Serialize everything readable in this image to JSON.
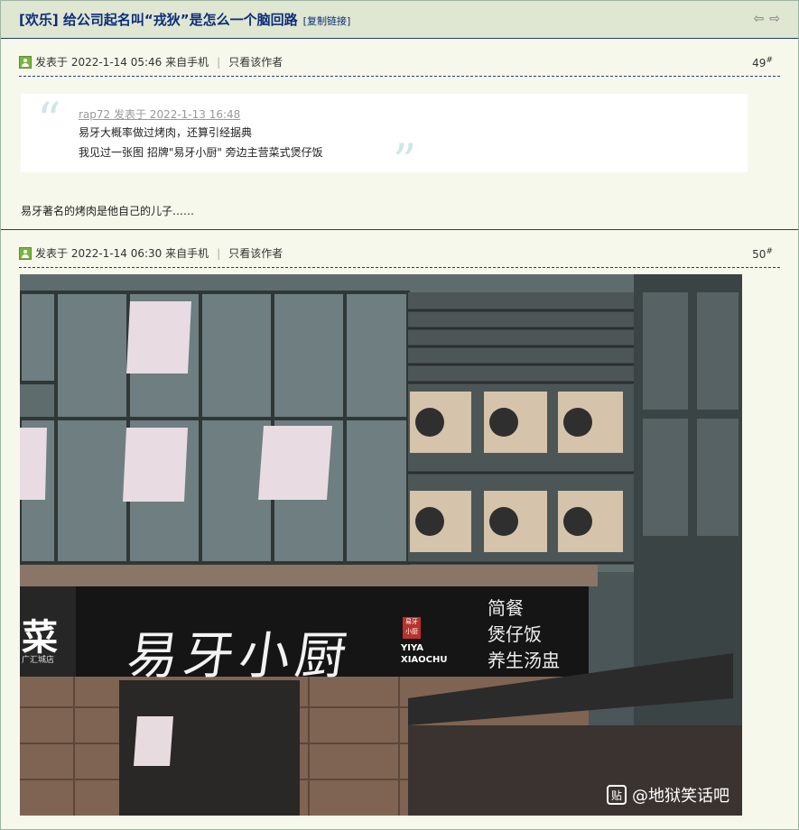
{
  "thread": {
    "title": "[欢乐] 给公司起名叫“戎狄”是怎么一个脑回路",
    "copy_link": "[复制链接]"
  },
  "nav": {
    "prev_icon": "arrow-left-icon",
    "next_icon": "arrow-right-icon"
  },
  "posts": [
    {
      "meta": "发表于 2022-1-14 05:46 来自手机",
      "only_author": "只看该作者",
      "floor": "49",
      "floor_mark": "#",
      "quote": {
        "author": "rap72 发表于 2022-1-13 16:48",
        "line1": "易牙大概率做过烤肉，还算引经据典",
        "line2": "我见过一张图 招牌\"易牙小厨\" 旁边主营菜式煲仔饭"
      },
      "reply": "易牙著名的烤肉是他自己的儿子……"
    },
    {
      "meta": "发表于 2022-1-14 06:30 来自手机",
      "only_author": "只看该作者",
      "floor": "50",
      "floor_mark": "#",
      "image": {
        "sign_main": "易牙小厨",
        "sign_seal": "易牙小厨",
        "sign_en": "YIYA\nXIAOCHU",
        "sign_menu": "简餐\n煲仔饭\n养生汤盅",
        "left_sign": "菜",
        "left_sign_small": "广汇城店",
        "watermark_badge": "贴",
        "watermark": "@地狱笑话吧"
      }
    }
  ],
  "colors": {
    "title": "#0b2d7a",
    "titlebar_bg": "#dfe6d1",
    "page_bg": "#f6f8ec",
    "rule": "#1f3d7a"
  }
}
